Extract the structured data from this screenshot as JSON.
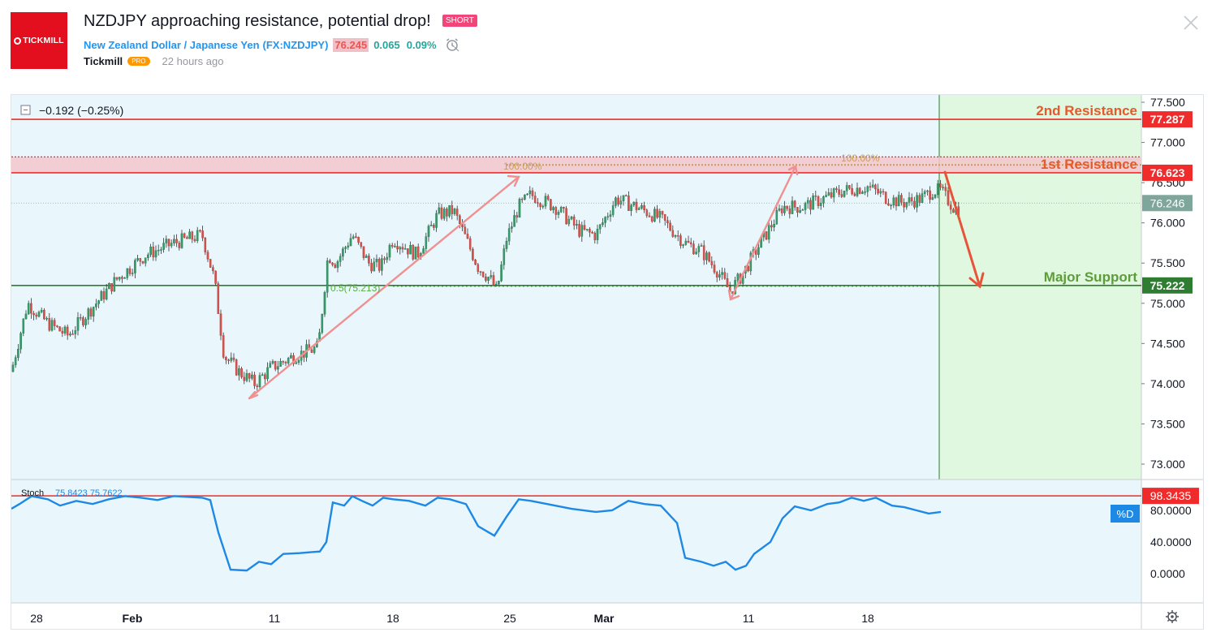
{
  "header": {
    "logo_text": "TICKMILL",
    "title": "NZDJPY approaching resistance, potential drop!",
    "direction_badge": "SHORT",
    "symbol_name": "New Zealand Dollar / Japanese Yen",
    "symbol_code": "(FX:NZDJPY)",
    "price": "76.245",
    "change": "0.065",
    "change_percent": "0.09%",
    "author": "Tickmill",
    "author_badge": "PRO",
    "published": "22 hours ago"
  },
  "chart": {
    "legend_change": "−0.192 (−0.25%)",
    "price_axis_ticks": [
      "77.500",
      "77.000",
      "76.500",
      "76.000",
      "75.500",
      "75.000",
      "74.500",
      "74.000",
      "73.500",
      "73.000"
    ],
    "price_tick_values": [
      77.5,
      77.0,
      76.5,
      76.0,
      75.5,
      75.0,
      74.5,
      74.0,
      73.5,
      73.0
    ],
    "time_axis_ticks": [
      "28",
      "Feb",
      "11",
      "18",
      "25",
      "Mar",
      "11",
      "18"
    ],
    "levels": [
      {
        "name": "2nd Resistance",
        "value": 77.287,
        "label": "77.287",
        "color": "#ef2b2b",
        "text_color": "#e45a2b"
      },
      {
        "name": "1st Resistance",
        "value": 76.623,
        "label": "76.623",
        "color": "#ef2b2b",
        "text_color": "#e45a2b"
      },
      {
        "name": "Major Support",
        "value": 75.222,
        "label": "75.222",
        "color": "#2e7d32",
        "text_color": "#5e9c3a"
      }
    ],
    "current_price_label": "76.246",
    "current_price_value": 76.246,
    "fib_labels": [
      "100.00%",
      "100.00%",
      "0.5(75.213)"
    ],
    "fib_values": {
      "high": 76.72,
      "mid": 75.213
    }
  },
  "stoch": {
    "legend_name": "Stoch",
    "legend_values": "75.8423  75.7622",
    "axis_ticks": [
      "80.0000",
      "40.0000",
      "0.0000"
    ],
    "axis_tick_values": [
      80,
      40,
      0
    ],
    "level_label": "98.3435",
    "level_value": 98.3435,
    "badge": "%D"
  },
  "colors": {
    "up": "#26a69a",
    "down": "#ef5350",
    "resistance": "#ef2b2b",
    "support": "#2e7d32",
    "projection": "#dff8df",
    "chart_bg": "#e9f7fd",
    "arrow": "#f09090",
    "forecast_arrow": "#e8543a"
  }
}
